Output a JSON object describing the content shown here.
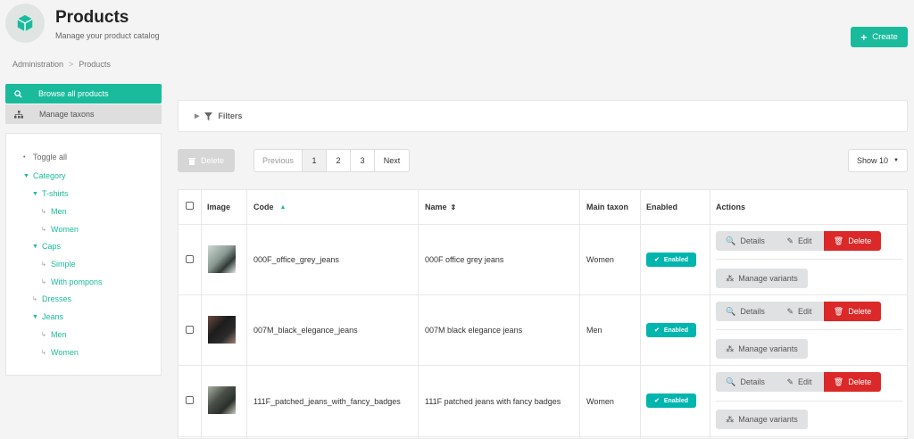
{
  "header": {
    "title": "Products",
    "subtitle": "Manage your product catalog",
    "create_label": "Create"
  },
  "breadcrumb": {
    "root": "Administration",
    "separator": ">",
    "current": "Products"
  },
  "nav": {
    "browse_label": "Browse all products",
    "taxons_label": "Manage taxons"
  },
  "tree": {
    "toggle_all": "Toggle all",
    "items": [
      {
        "label": "Category"
      },
      {
        "label": "T-shirts"
      },
      {
        "label": "Men"
      },
      {
        "label": "Women"
      },
      {
        "label": "Caps"
      },
      {
        "label": "Simple"
      },
      {
        "label": "With pompons"
      },
      {
        "label": "Dresses"
      },
      {
        "label": "Jeans"
      },
      {
        "label": "Men"
      },
      {
        "label": "Women"
      }
    ]
  },
  "filters": {
    "label": "Filters"
  },
  "toolbar": {
    "delete_label": "Delete",
    "pagination": {
      "previous": "Previous",
      "pages": [
        "1",
        "2",
        "3"
      ],
      "next": "Next",
      "current": "1"
    },
    "show_label": "Show 10"
  },
  "table": {
    "headers": {
      "image": "Image",
      "code": "Code",
      "name": "Name",
      "main_taxon": "Main taxon",
      "enabled": "Enabled",
      "actions": "Actions"
    },
    "rows": [
      {
        "code": "000F_office_grey_jeans",
        "name": "000F office grey jeans",
        "main_taxon": "Women",
        "enabled": "Enabled"
      },
      {
        "code": "007M_black_elegance_jeans",
        "name": "007M black elegance jeans",
        "main_taxon": "Men",
        "enabled": "Enabled"
      },
      {
        "code": "111F_patched_jeans_with_fancy_badges",
        "name": "111F patched jeans with fancy badges",
        "main_taxon": "Women",
        "enabled": "Enabled"
      }
    ],
    "actions": {
      "details": "Details",
      "edit": "Edit",
      "delete": "Delete",
      "manage_variants": "Manage variants"
    }
  },
  "colors": {
    "accent": "#1abb9c",
    "enabled": "#00b5ad",
    "danger": "#db2828"
  }
}
